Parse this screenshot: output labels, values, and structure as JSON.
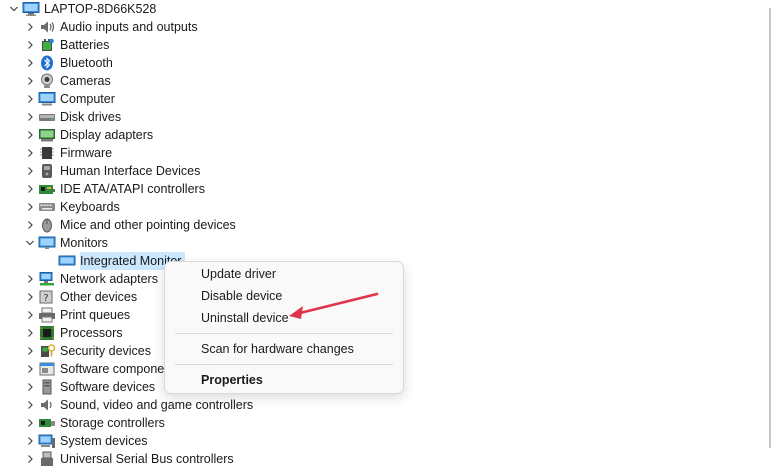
{
  "tree": {
    "root_label": "LAPTOP-8D66K528",
    "categories": [
      {
        "label": "Audio inputs and outputs",
        "icon": "speaker-icon"
      },
      {
        "label": "Batteries",
        "icon": "battery-icon"
      },
      {
        "label": "Bluetooth",
        "icon": "bluetooth-icon"
      },
      {
        "label": "Cameras",
        "icon": "camera-icon"
      },
      {
        "label": "Computer",
        "icon": "computer-icon"
      },
      {
        "label": "Disk drives",
        "icon": "disk-drive-icon"
      },
      {
        "label": "Display adapters",
        "icon": "display-adapter-icon"
      },
      {
        "label": "Firmware",
        "icon": "firmware-icon"
      },
      {
        "label": "Human Interface Devices",
        "icon": "hid-icon"
      },
      {
        "label": "IDE ATA/ATAPI controllers",
        "icon": "ide-controller-icon"
      },
      {
        "label": "Keyboards",
        "icon": "keyboard-icon"
      },
      {
        "label": "Mice and other pointing devices",
        "icon": "mouse-icon"
      },
      {
        "label": "Monitors",
        "icon": "monitor-icon",
        "expanded": true
      },
      {
        "label": "Network adapters",
        "icon": "network-adapter-icon"
      },
      {
        "label": "Other devices",
        "icon": "other-devices-icon"
      },
      {
        "label": "Print queues",
        "icon": "printer-icon"
      },
      {
        "label": "Processors",
        "icon": "processor-icon"
      },
      {
        "label": "Security devices",
        "icon": "security-device-icon"
      },
      {
        "label": "Software components",
        "icon": "software-component-icon"
      },
      {
        "label": "Software devices",
        "icon": "software-device-icon"
      },
      {
        "label": "Sound, video and game controllers",
        "icon": "sound-controller-icon"
      },
      {
        "label": "Storage controllers",
        "icon": "storage-controller-icon"
      },
      {
        "label": "System devices",
        "icon": "system-device-icon"
      },
      {
        "label": "Universal Serial Bus controllers",
        "icon": "usb-controller-icon"
      }
    ],
    "selected_child": {
      "label": "Integrated Monitor",
      "icon": "monitor-icon"
    }
  },
  "context_menu": {
    "items": [
      "Update driver",
      "Disable device",
      "Uninstall device",
      "Scan for hardware changes",
      "Properties"
    ]
  },
  "annotation": {
    "arrow_color": "#e0344a"
  },
  "colors": {
    "selection": "#cce8ff",
    "menu_bg": "#f9f9f9"
  }
}
